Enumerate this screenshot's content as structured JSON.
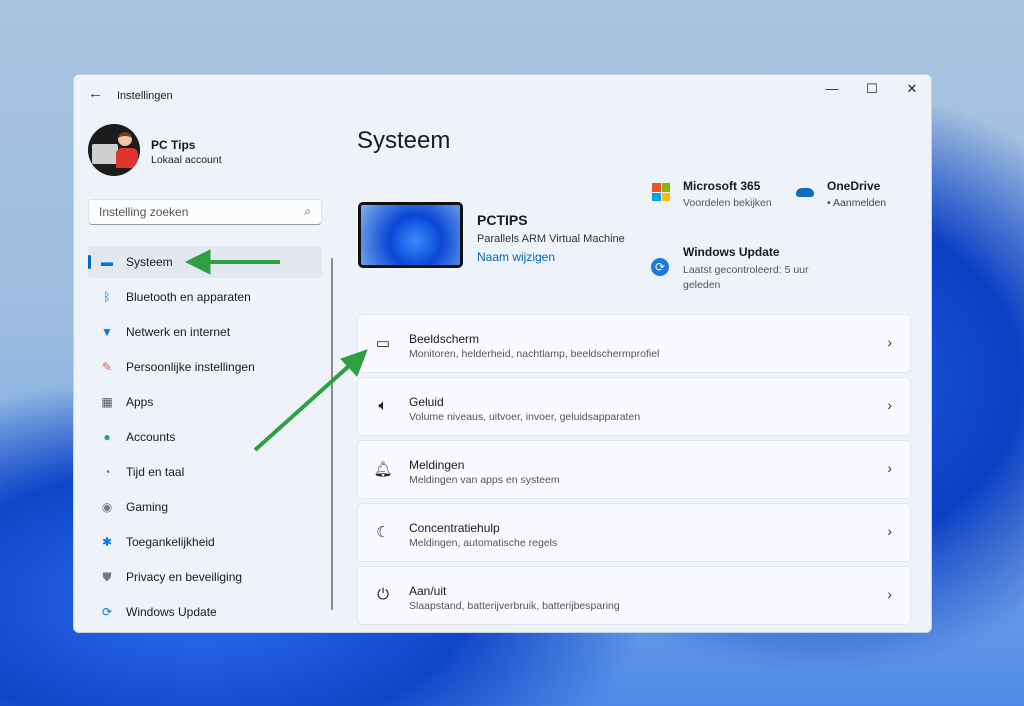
{
  "window": {
    "title": "Instellingen",
    "minimize": "—",
    "maximize": "☐",
    "close": "✕",
    "back": "←"
  },
  "account": {
    "name": "PC Tips",
    "type": "Lokaal account"
  },
  "search": {
    "placeholder": "Instelling zoeken"
  },
  "sidebar": {
    "items": [
      {
        "label": "Systeem",
        "icon": "monitor-icon"
      },
      {
        "label": "Bluetooth en apparaten",
        "icon": "bluetooth-icon"
      },
      {
        "label": "Netwerk en internet",
        "icon": "wifi-icon"
      },
      {
        "label": "Persoonlijke instellingen",
        "icon": "brush-icon"
      },
      {
        "label": "Apps",
        "icon": "apps-icon"
      },
      {
        "label": "Accounts",
        "icon": "person-icon"
      },
      {
        "label": "Tijd en taal",
        "icon": "globe-clock-icon"
      },
      {
        "label": "Gaming",
        "icon": "gamepad-icon"
      },
      {
        "label": "Toegankelijkheid",
        "icon": "accessibility-icon"
      },
      {
        "label": "Privacy en beveiliging",
        "icon": "shield-icon"
      },
      {
        "label": "Windows Update",
        "icon": "update-icon"
      }
    ]
  },
  "main": {
    "title": "Systeem",
    "device": {
      "name": "PCTIPS",
      "model": "Parallels ARM Virtual Machine",
      "rename": "Naam wijzigen"
    },
    "tiles": {
      "m365_title": "Microsoft 365",
      "m365_sub": "Voordelen bekijken",
      "onedrive_title": "OneDrive",
      "onedrive_sub": "• Aanmelden",
      "wu_title": "Windows Update",
      "wu_sub": "Laatst gecontroleerd: 5 uur geleden"
    },
    "cards": [
      {
        "title": "Beeldscherm",
        "subtitle": "Monitoren, helderheid, nachtlamp, beeldschermprofiel"
      },
      {
        "title": "Geluid",
        "subtitle": "Volume niveaus, uitvoer, invoer, geluidsapparaten"
      },
      {
        "title": "Meldingen",
        "subtitle": "Meldingen van apps en systeem"
      },
      {
        "title": "Concentratiehulp",
        "subtitle": "Meldingen, automatische regels"
      },
      {
        "title": "Aan/uit",
        "subtitle": "Slaapstand, batterijverbruik, batterijbesparing"
      }
    ]
  },
  "colors": {
    "accent": "#0067c0",
    "arrow": "#2ea043"
  }
}
